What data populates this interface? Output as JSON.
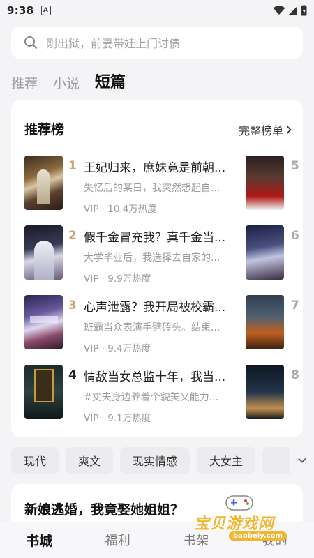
{
  "status": {
    "time": "9:38",
    "badge": "A"
  },
  "search": {
    "placeholder": "刚出狱，前妻带娃上门讨债"
  },
  "top_tabs": [
    {
      "label": "推荐"
    },
    {
      "label": "小说"
    },
    {
      "label": "短篇"
    }
  ],
  "ranking": {
    "title": "推荐榜",
    "more_label": "完整榜单",
    "books": [
      {
        "rank": "1",
        "title": "王妃归来，庶妹竟是前朝...",
        "desc": "失忆后的某日，我突然想起自...",
        "meta": "VIP · 10.4万热度"
      },
      {
        "rank": "2",
        "title": "假千金冒充我？真千金当...",
        "desc": "大学毕业后，我选择去自家的...",
        "meta": "VIP · 9.9万热度"
      },
      {
        "rank": "3",
        "title": "心声泄露？我开局被校霸...",
        "desc": "班霸当众表演手劈砖头。结束...",
        "meta": "VIP · 9.4万热度"
      },
      {
        "rank": "4",
        "title": "情敌当女总监十年，我当...",
        "desc": "#丈夫身边养着个貌美又能力...",
        "meta": "VIP · 9.1万热度"
      }
    ],
    "side_ranks": [
      "5",
      "6",
      "7",
      "8"
    ]
  },
  "genres": [
    {
      "label": "现代"
    },
    {
      "label": "爽文"
    },
    {
      "label": "现实情感"
    },
    {
      "label": "大女主"
    }
  ],
  "feature": {
    "title": "新娘逃婚，我竟娶她姐姐？"
  },
  "bottom_nav": [
    {
      "label": "书城"
    },
    {
      "label": "福利"
    },
    {
      "label": "书架"
    },
    {
      "label": "我的"
    }
  ],
  "watermark": {
    "text": "宝贝游戏网",
    "url": "baobeiy.com"
  },
  "colors": {
    "rank_top": "#c8a571",
    "rank_other": "#222222",
    "accent_watermark": "#f2b531"
  }
}
